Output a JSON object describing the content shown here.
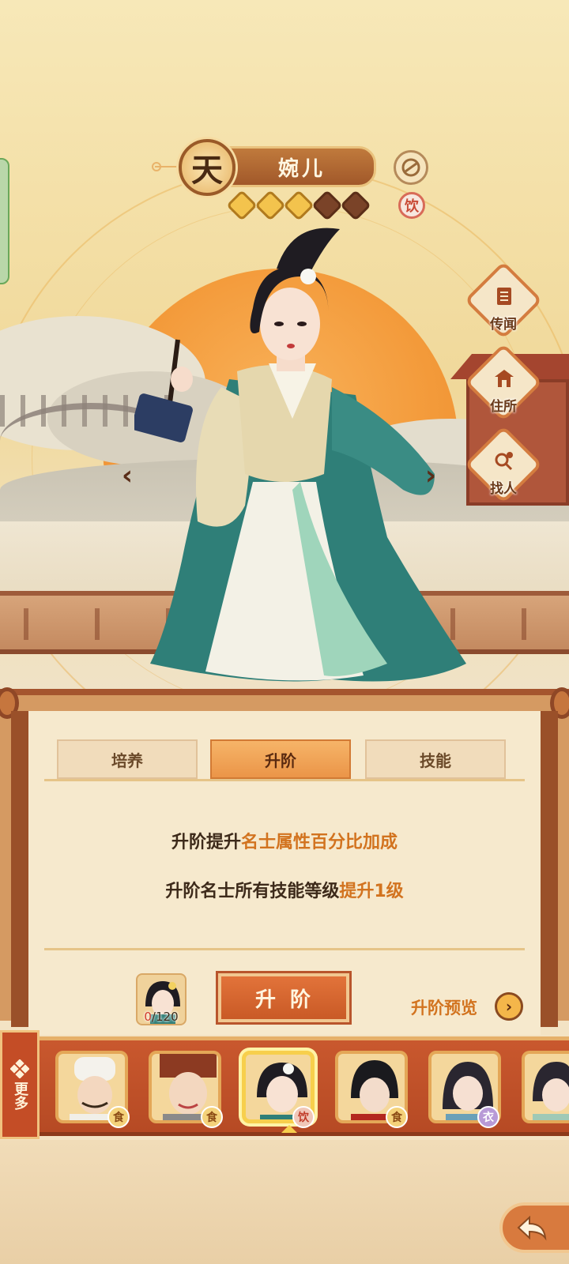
{
  "character": {
    "rank": "天",
    "name": "婉儿",
    "stars_filled": 3,
    "stars_total": 5,
    "type_badge": "饮"
  },
  "side_menu": [
    {
      "label": "传闻",
      "icon": "scroll-icon"
    },
    {
      "label": "住所",
      "icon": "house-icon"
    },
    {
      "label": "找人",
      "icon": "search-person-icon"
    }
  ],
  "tabs": [
    {
      "label": "培养",
      "active": false
    },
    {
      "label": "升阶",
      "active": true
    },
    {
      "label": "技能",
      "active": false
    }
  ],
  "description": {
    "line1_prefix": "升阶提升",
    "line1_highlight": "名士属性百分比加成",
    "line2_prefix": "升阶名士所有技能等级",
    "line2_highlight": "提升1级"
  },
  "upgrade": {
    "count_current": "0",
    "count_total": "/120",
    "button_label": "升阶",
    "preview_label": "升阶预览"
  },
  "roster": {
    "more_label": "更多",
    "cards": [
      {
        "tag": "食",
        "tag_type": "food",
        "selected": false
      },
      {
        "tag": "食",
        "tag_type": "food",
        "selected": false
      },
      {
        "tag": "饮",
        "tag_type": "drink",
        "selected": true
      },
      {
        "tag": "食",
        "tag_type": "food",
        "selected": false
      },
      {
        "tag": "衣",
        "tag_type": "cloth",
        "selected": false
      }
    ]
  },
  "colors": {
    "accent_orange": "#d2731f",
    "panel_brown": "#a5552e",
    "active_tab": "#eb9548"
  }
}
